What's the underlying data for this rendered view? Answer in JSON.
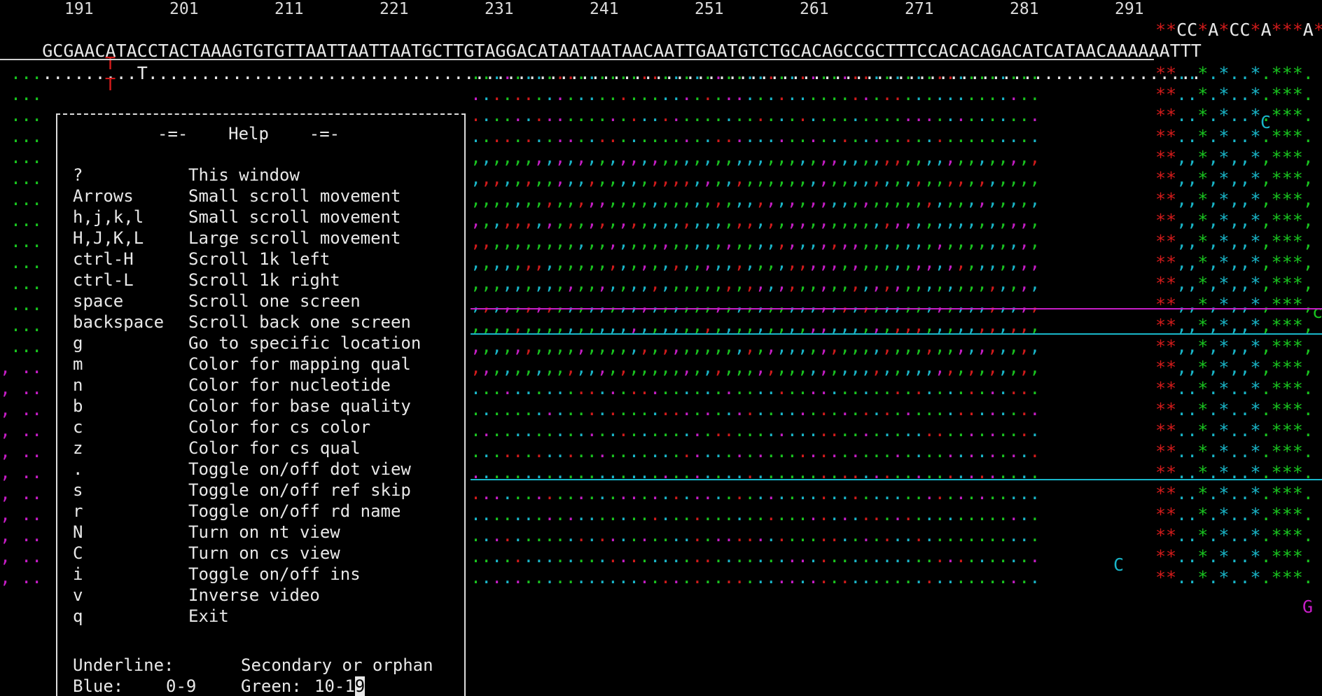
{
  "positions": [
    "191",
    "201",
    "211",
    "221",
    "231",
    "241",
    "251",
    "261",
    "271",
    "281",
    "291"
  ],
  "reference_seq": "GCGAACATACCTACTAAAGTGTGTTAATTAATTAATGCTTGTAGGACATAATAATAACAATTGAATGTCTGCACAGCCGCTTTCCACACAGACATCATAACAAAAAATTT",
  "reference_tail": [
    "**",
    "CC",
    "*",
    "A",
    "*",
    "CC",
    "*",
    "A",
    "***",
    "A*"
  ],
  "consensus_mark": "T",
  "mismatch_rows": [
    "T",
    "T"
  ],
  "help": {
    "title": "-=-    Help    -=-",
    "keys": [
      {
        "key": "?",
        "desc": "This window"
      },
      {
        "key": "Arrows",
        "desc": "Small scroll movement"
      },
      {
        "key": "h,j,k,l",
        "desc": "Small scroll movement"
      },
      {
        "key": "H,J,K,L",
        "desc": "Large scroll movement"
      },
      {
        "key": "ctrl-H",
        "desc": "Scroll 1k left"
      },
      {
        "key": "ctrl-L",
        "desc": "Scroll 1k right"
      },
      {
        "key": "space",
        "desc": "Scroll one screen"
      },
      {
        "key": "backspace",
        "desc": "Scroll back one screen"
      },
      {
        "key": "g",
        "desc": "Go to specific location"
      },
      {
        "key": "m",
        "desc": "Color for mapping qual"
      },
      {
        "key": "n",
        "desc": "Color for nucleotide"
      },
      {
        "key": "b",
        "desc": "Color for base quality"
      },
      {
        "key": "c",
        "desc": "Color for cs color"
      },
      {
        "key": "z",
        "desc": "Color for cs qual"
      },
      {
        "key": ".",
        "desc": "Toggle on/off dot view"
      },
      {
        "key": "s",
        "desc": "Toggle on/off ref skip"
      },
      {
        "key": "r",
        "desc": "Toggle on/off rd name"
      },
      {
        "key": "N",
        "desc": "Turn on nt view"
      },
      {
        "key": "C",
        "desc": "Turn on cs view"
      },
      {
        "key": "i",
        "desc": "Toggle on/off ins"
      },
      {
        "key": "v",
        "desc": "Inverse video"
      },
      {
        "key": "q",
        "desc": "Exit"
      }
    ],
    "underline_label": "Underline:",
    "underline_desc": "Secondary or orphan",
    "blue_label": "Blue:",
    "blue_range": "0-9",
    "green_label": "Green:",
    "green_range": "10-1",
    "green_range_cursor": "9"
  },
  "read_letters": {
    "c_right_1": "C",
    "c_right_2": "C",
    "c_row_8": "c",
    "g_row_24": "G"
  },
  "colors": {
    "green": "#19c41f",
    "cyan": "#19b6c9",
    "red": "#d21b1b",
    "magenta": "#c61dc6",
    "white": "#e8e8e8"
  }
}
